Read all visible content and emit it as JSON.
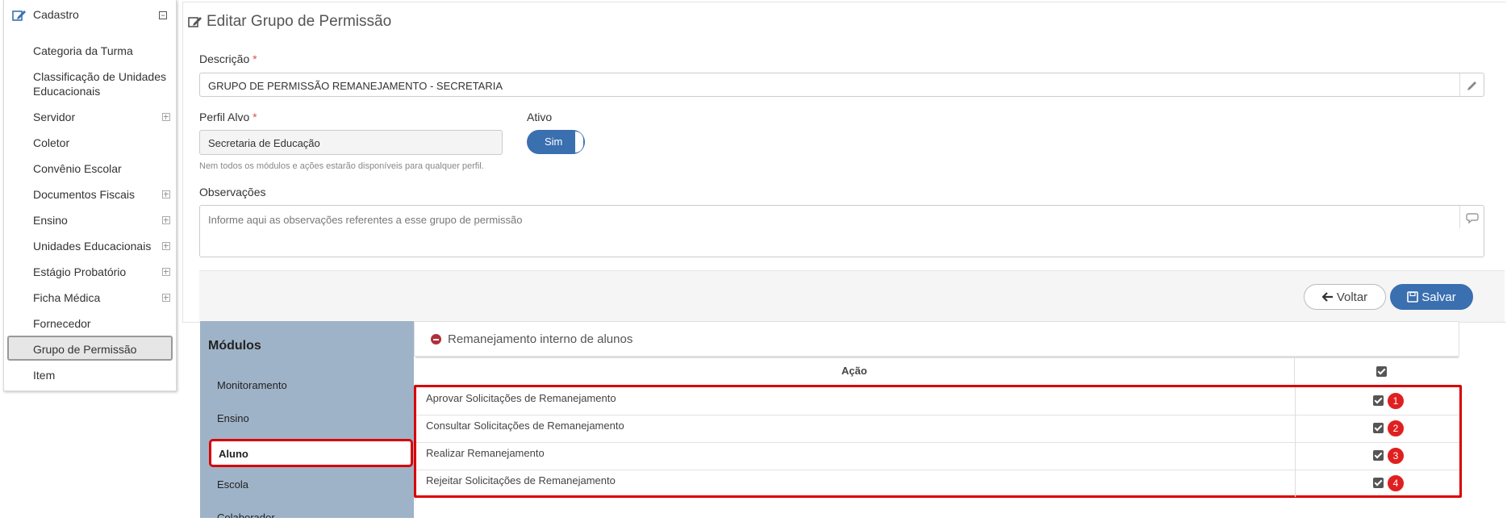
{
  "sidebar": {
    "header": "Cadastro",
    "items": [
      {
        "label": "Categoria da Turma"
      },
      {
        "label": "Classificação de Unidades Educacionais"
      },
      {
        "label": "Servidor"
      },
      {
        "label": "Coletor"
      },
      {
        "label": "Convênio Escolar"
      },
      {
        "label": "Documentos Fiscais"
      },
      {
        "label": "Ensino"
      },
      {
        "label": "Unidades Educacionais"
      },
      {
        "label": "Estágio Probatório"
      },
      {
        "label": "Ficha Médica"
      },
      {
        "label": "Fornecedor"
      },
      {
        "label": "Grupo de Permissão"
      },
      {
        "label": "Item"
      }
    ]
  },
  "form": {
    "title": "Editar Grupo de Permissão",
    "descricao_label": "Descrição",
    "required_mark": "*",
    "descricao_value": "GRUPO DE PERMISSÃO REMANEJAMENTO - SECRETARIA",
    "perfil_label": "Perfil Alvo",
    "perfil_value": "Secretaria de Educação",
    "perfil_hint": "Nem todos os módulos e ações estarão disponíveis para qualquer perfil.",
    "ativo_label": "Ativo",
    "ativo_value": "Sim",
    "observacoes_label": "Observações",
    "observacoes_placeholder": "Informe aqui as observações referentes a esse grupo de permissão"
  },
  "buttons": {
    "voltar": "Voltar",
    "salvar": "Salvar"
  },
  "modules": {
    "title": "Módulos",
    "items": [
      "Monitoramento",
      "Ensino",
      "Aluno",
      "Escola",
      "Colaborador"
    ],
    "selected": "Aluno"
  },
  "permissions": {
    "section_title": "Remanejamento interno de alunos",
    "column_header": "Ação",
    "rows": [
      {
        "label": "Aprovar Solicitações de Remanejamento",
        "checked": true,
        "badge": "1"
      },
      {
        "label": "Consultar Solicitações de Remanejamento",
        "checked": true,
        "badge": "2"
      },
      {
        "label": "Realizar Remanejamento",
        "checked": true,
        "badge": "3"
      },
      {
        "label": "Rejeitar Solicitações de Remanejamento",
        "checked": true,
        "badge": "4"
      }
    ]
  },
  "colors": {
    "primary": "#3a6fb0",
    "highlight": "#d90000",
    "modules_bg": "#9fb3c8"
  }
}
